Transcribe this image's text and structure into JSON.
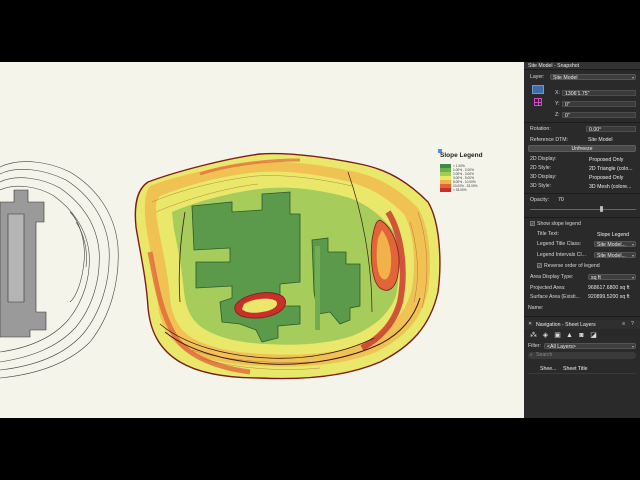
{
  "legend": {
    "title": "Slope Legend",
    "rows": [
      {
        "text": "< 1.00%",
        "color": "#3f8a45"
      },
      {
        "text": "1.00% - 2.00%",
        "color": "#6fae52"
      },
      {
        "text": "2.00% - 3.00%",
        "color": "#a6cc5c"
      },
      {
        "text": "3.00% - 5.00%",
        "color": "#e9e86a"
      },
      {
        "text": "5.00% - 10.00%",
        "color": "#f2b24a"
      },
      {
        "text": "10.00% - 33.00%",
        "color": "#e2653a"
      },
      {
        "text": "> 33.00%",
        "color": "#c9302c"
      }
    ]
  },
  "panel": {
    "title": "Site Model - Snapshot",
    "layer_label": "Layer:",
    "layer_value": "Site Model",
    "x_label": "X:",
    "x_value": "1306'1.75\"",
    "y_label": "Y:",
    "y_value": "0\"",
    "z_label": "Z:",
    "z_value": "0\"",
    "rotation_label": "Rotation:",
    "rotation_value": "0.00°",
    "reference_label": "Reference DTM:",
    "reference_value": "Site Model",
    "unfreeze_label": "Unfreeze",
    "display2d_label": "2D Display:",
    "display2d_value": "Proposed Only",
    "style2d_label": "2D Style:",
    "style2d_value": "2D Triangle (colo...",
    "display3d_label": "3D Display:",
    "display3d_value": "Proposed Only",
    "style3d_label": "3D Style:",
    "style3d_value": "3D Mesh (colore...",
    "opacity_label": "Opacity:",
    "opacity_value": "70",
    "show_slope_label": "Show slope legend",
    "title_text_label": "Title Text:",
    "title_text_value": "Slope Legend",
    "legend_title_class_label": "Legend Title Class:",
    "legend_title_class_value": "Site Model...",
    "legend_intervals_label": "Legend Intervals Cl...",
    "legend_intervals_value": "Site Model...",
    "reverse_label": "Reverse order of legend",
    "area_display_label": "Area Display Type:",
    "area_display_value": "sq ft",
    "projected_label": "Projected Area:",
    "projected_value": "968617.6800 sq ft",
    "surface_label": "Surface Area (Existi...",
    "surface_value": "920899.5200 sq ft",
    "name_label": "Name:"
  },
  "navigation": {
    "title": "Navigation - Sheet Layers",
    "filter_label": "Filter:",
    "filter_value": "<All Layers>",
    "search_placeholder": "Search",
    "col1": "Shee...",
    "col2": "Sheet Title"
  }
}
